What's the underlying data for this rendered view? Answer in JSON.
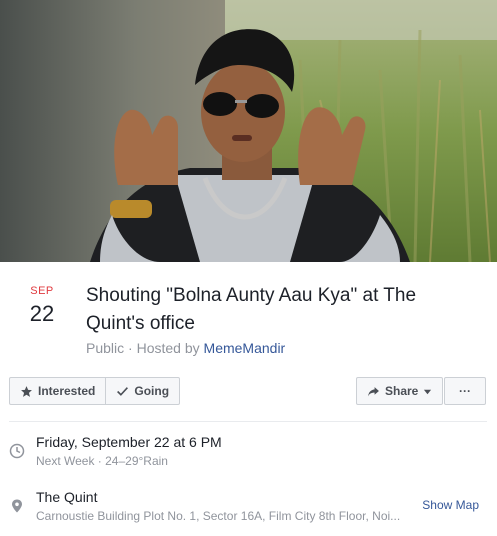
{
  "event": {
    "month": "SEP",
    "day": "22",
    "title": "Shouting \"Bolna Aunty Aau Kya\" at The Quint's office",
    "privacy": "Public",
    "separator": " · ",
    "hosted_by_prefix": "Hosted by ",
    "host": "MemeMandir"
  },
  "actions": {
    "interested_label": "Interested",
    "going_label": "Going",
    "share_label": "Share",
    "more_label": "···"
  },
  "time": {
    "main": "Friday, September 22 at 6 PM",
    "sub": "Next Week · 24–29°Rain"
  },
  "location": {
    "name": "The Quint",
    "address": "Carnoustie Building Plot No. 1, Sector 16A, Film City 8th Floor, Noi...",
    "map_label": "Show Map"
  },
  "icons": {
    "interested": "star-icon",
    "going": "check-icon",
    "share": "share-arrow-icon",
    "share_caret": "caret-down-icon",
    "time": "clock-icon",
    "location": "map-pin-icon"
  },
  "colors": {
    "month": "#e0393e",
    "link": "#365899",
    "muted": "#90949c",
    "button_bg": "#f6f7f9",
    "border": "#ccd0d5"
  }
}
